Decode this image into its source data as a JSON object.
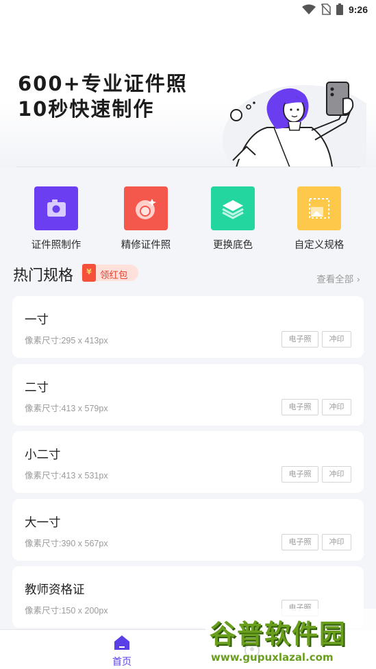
{
  "status_bar": {
    "time": "9:26"
  },
  "banner": {
    "line1": "600+专业证件照",
    "line2": "10秒快速制作"
  },
  "actions": [
    {
      "label": "证件照制作",
      "color": "#6b3ef2",
      "icon": "camera-icon"
    },
    {
      "label": "精修证件照",
      "color": "#f4574c",
      "icon": "portrait-retouch-icon"
    },
    {
      "label": "更换底色",
      "color": "#23d6a0",
      "icon": "layers-icon"
    },
    {
      "label": "自定义规格",
      "color": "#fec84b",
      "icon": "crop-image-icon"
    }
  ],
  "section": {
    "title": "热门规格",
    "redpack_label": "领红包",
    "view_all": "查看全部"
  },
  "tags": {
    "electronic": "电子照",
    "print": "冲印"
  },
  "specs": [
    {
      "name": "一寸",
      "size": "像素尺寸:295 x 413px"
    },
    {
      "name": "二寸",
      "size": "像素尺寸:413 x 579px"
    },
    {
      "name": "小二寸",
      "size": "像素尺寸:413 x 531px"
    },
    {
      "name": "大一寸",
      "size": "像素尺寸:390 x 567px"
    },
    {
      "name": "教师资格证",
      "size": "像素尺寸:150 x 200px"
    }
  ],
  "bottom_nav": {
    "home_label": "首页",
    "accent": "#5b3fe6"
  },
  "watermark": {
    "title": "谷普软件园",
    "url": "www.gupuxlazal.com"
  }
}
